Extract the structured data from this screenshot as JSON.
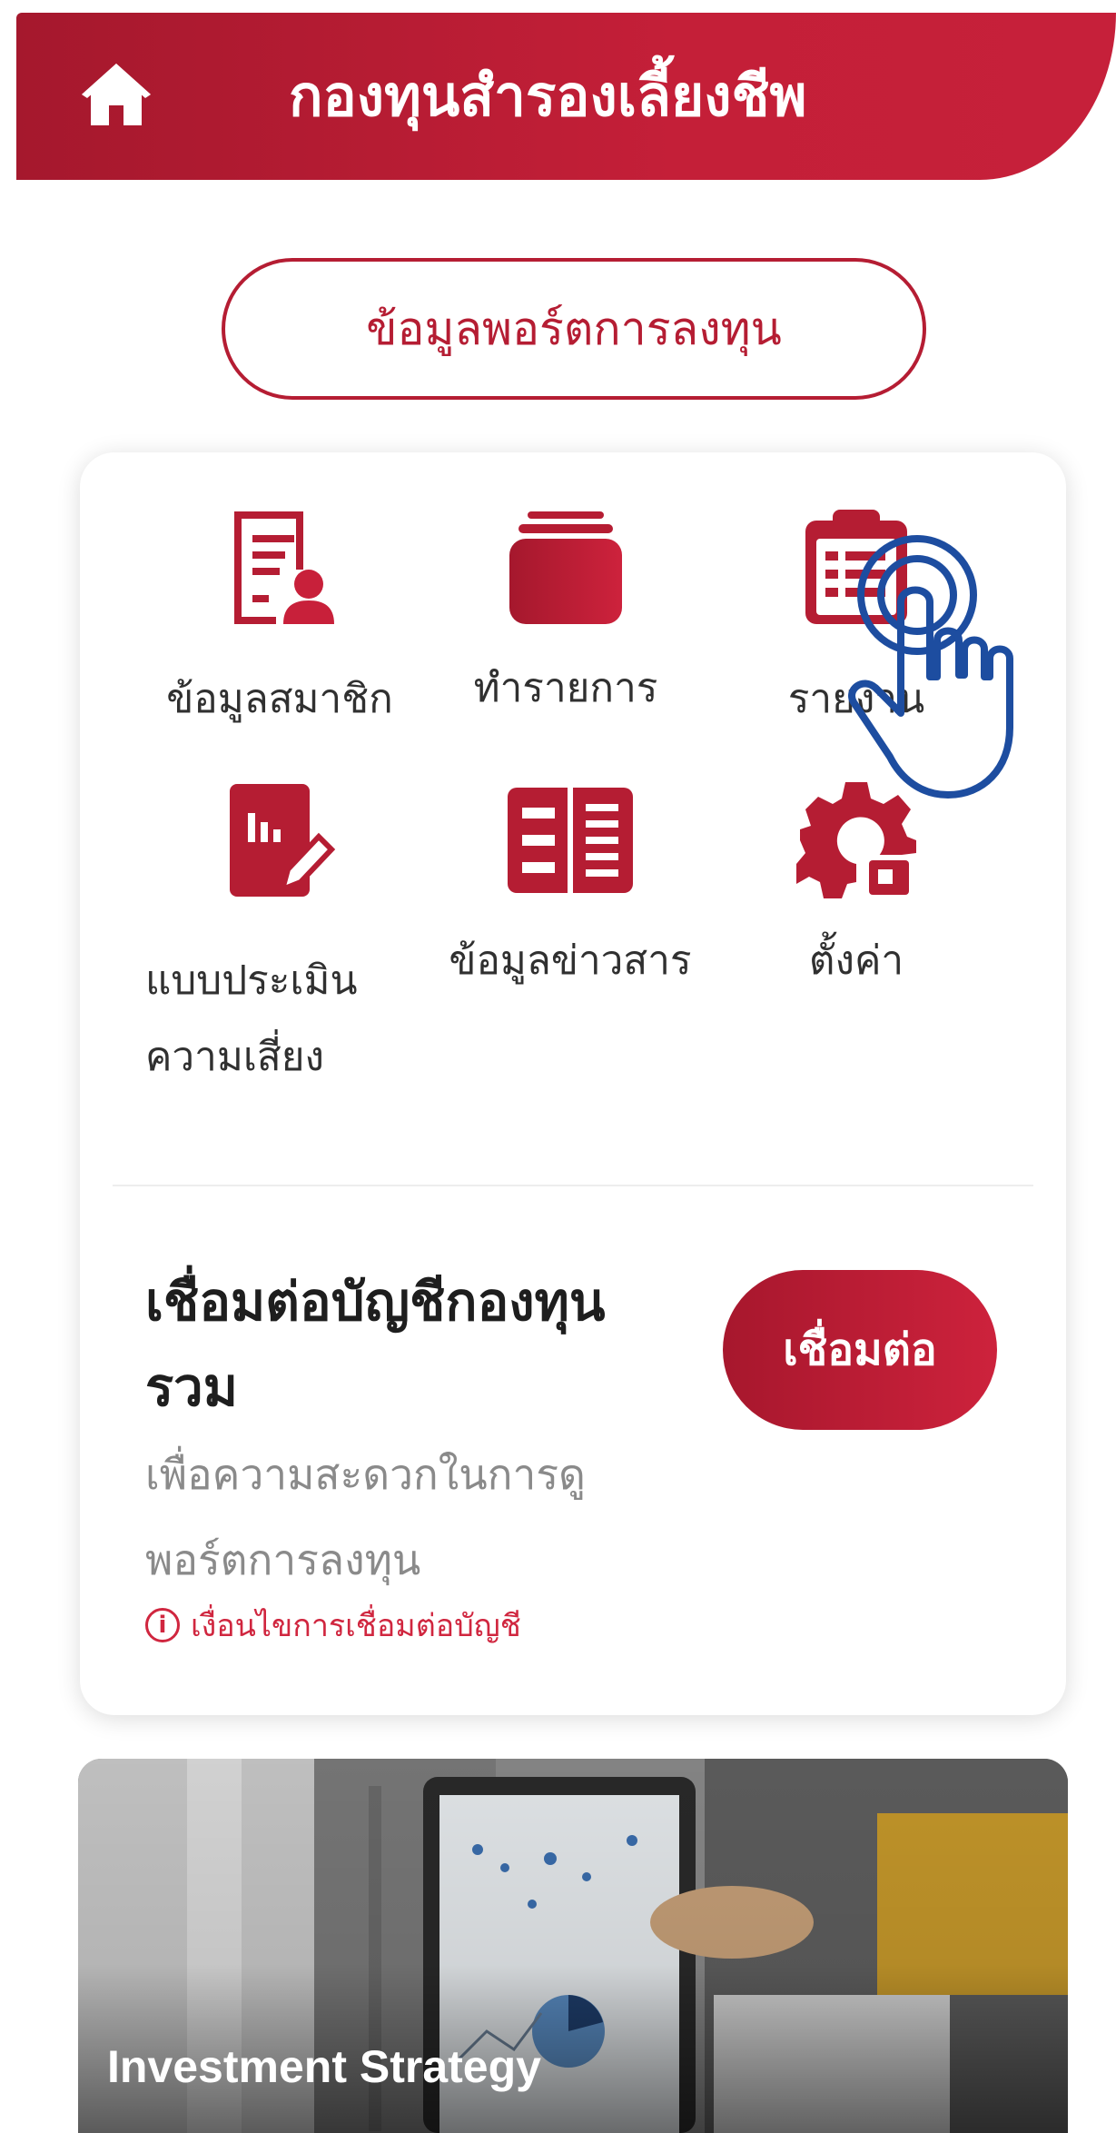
{
  "header": {
    "title": "กองทุนสำรองเลี้ยงชีพ",
    "home_icon": "home-icon"
  },
  "portfolio_button": {
    "label": "ข้อมูลพอร์ตการลงทุน"
  },
  "menu": {
    "items": [
      {
        "label": "ข้อมูลสมาชิก",
        "icon": "member-profile-icon"
      },
      {
        "label": "ทำรายการ",
        "icon": "transaction-stack-icon"
      },
      {
        "label": "รายงาน",
        "icon": "report-clipboard-icon"
      },
      {
        "label_line1": "แบบประเมิน",
        "label_line2": "ความเสี่ยง",
        "icon": "risk-assessment-icon"
      },
      {
        "label": "ข้อมูลข่าวสาร",
        "icon": "news-icon"
      },
      {
        "label": "ตั้งค่า",
        "icon": "settings-gear-icon"
      }
    ]
  },
  "connect": {
    "title_line1": "เชื่อมต่อบัญชีกองทุน",
    "title_line2": "รวม",
    "subtitle_line1": "เพื่อความสะดวกในการดู",
    "subtitle_line2": "พอร์ตการลงทุน",
    "condition": "เงื่อนไขการเชื่อมต่อบัญชี",
    "button_label": "เชื่อมต่อ"
  },
  "banner": {
    "title": "Investment Strategy"
  },
  "overlay": {
    "icon": "tap-hand-icon"
  },
  "colors": {
    "brand_red": "#b51d33",
    "header_gradient_start": "#a5182d",
    "header_gradient_end": "#c6203a",
    "condition_red": "#d0263f",
    "hand_blue": "#1d4da0"
  }
}
